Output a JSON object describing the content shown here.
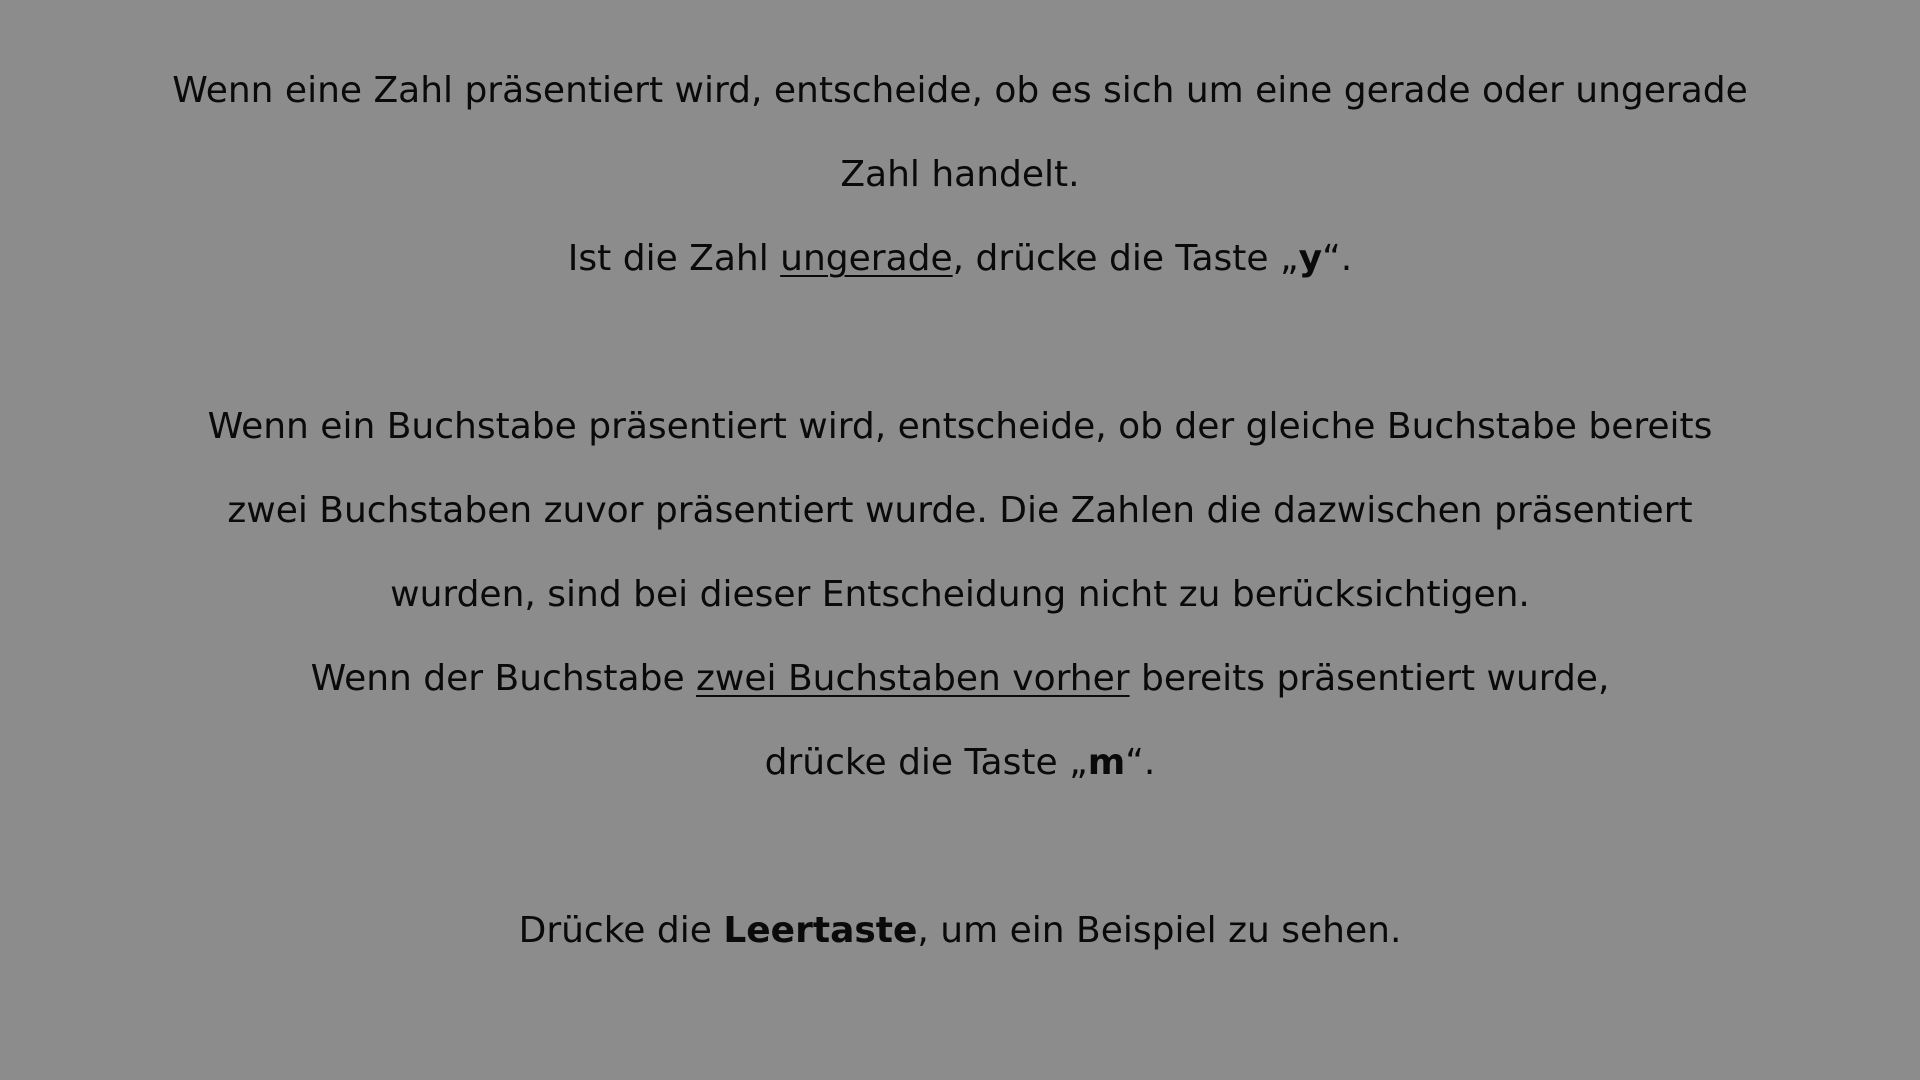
{
  "instructions": {
    "numbers": {
      "line1": "Wenn eine Zahl präsentiert wird, entscheide, ob es sich um eine gerade oder ungerade",
      "line2": "Zahl handelt.",
      "rule": {
        "pre": "Ist die Zahl ",
        "underlined": "ungerade",
        "mid": ", drücke die Taste „",
        "key": "y",
        "post": "“."
      }
    },
    "letters": {
      "line1": "Wenn ein Buchstabe präsentiert wird, entscheide, ob der gleiche Buchstabe bereits",
      "line2": "zwei Buchstaben zuvor präsentiert wurde. Die Zahlen die dazwischen präsentiert",
      "line3": "wurden, sind bei dieser Entscheidung nicht zu berücksichtigen.",
      "rule": {
        "pre": "Wenn der Buchstabe ",
        "underlined": "zwei Buchstaben vorher",
        "post": " bereits präsentiert wurde,",
        "line2_pre": "drücke die Taste „",
        "key": "m",
        "line2_post": "“."
      }
    },
    "continue": {
      "pre": "Drücke die ",
      "key": "Leertaste",
      "post": ", um ein Beispiel zu sehen."
    }
  }
}
